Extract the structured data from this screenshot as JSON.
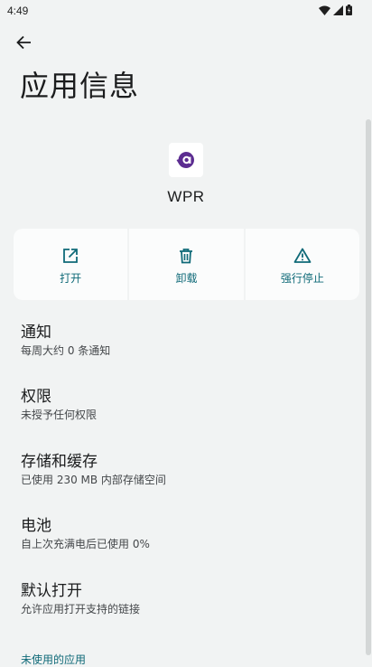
{
  "status_bar": {
    "time": "4:49",
    "icons": [
      "wifi-icon",
      "signal-icon",
      "battery-icon"
    ]
  },
  "header": {
    "back_icon": "arrow-back-icon",
    "title": "应用信息"
  },
  "app": {
    "name": "WPR",
    "icon_color": "#5c2d91"
  },
  "actions": [
    {
      "label": "打开",
      "icon": "open-in-new-icon"
    },
    {
      "label": "卸载",
      "icon": "trash-icon"
    },
    {
      "label": "强行停止",
      "icon": "warning-icon"
    }
  ],
  "settings": [
    {
      "title": "通知",
      "summary": "每周大约 0 条通知"
    },
    {
      "title": "权限",
      "summary": "未授予任何权限"
    },
    {
      "title": "存储和缓存",
      "summary": "已使用 230 MB 内部存储空间"
    },
    {
      "title": "电池",
      "summary": "自上次充满电后已使用 0%"
    },
    {
      "title": "默认打开",
      "summary": "允许应用打开支持的链接"
    }
  ],
  "section_header": "未使用的应用",
  "colors": {
    "background": "#f1f3f3",
    "accent": "#0f6a78",
    "card": "#fbfcfc"
  }
}
